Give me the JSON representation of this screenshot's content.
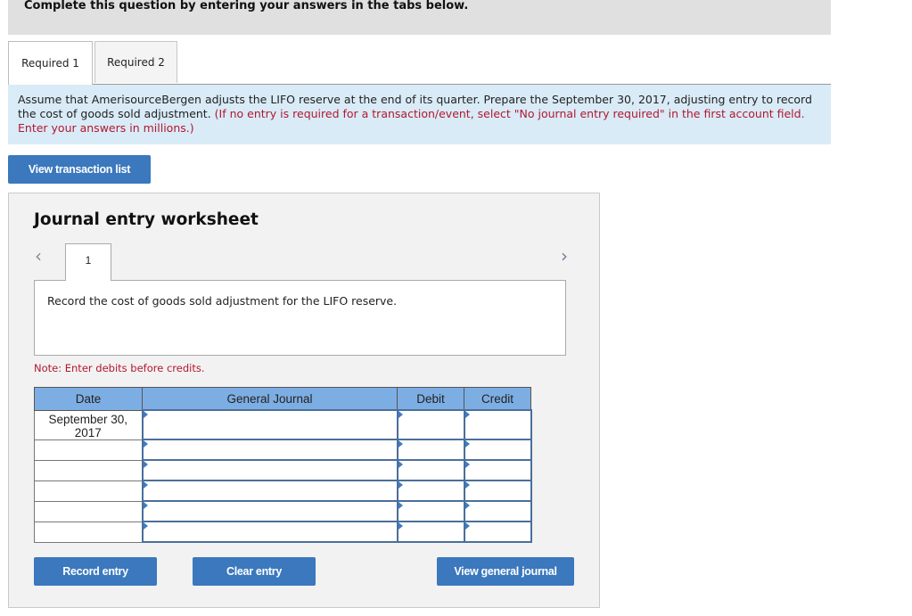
{
  "banner": {
    "text": "Complete this question by entering your answers in the tabs below."
  },
  "tabs": [
    {
      "label": "Required 1",
      "active": true
    },
    {
      "label": "Required 2",
      "active": false
    }
  ],
  "instructions": {
    "text": "Assume that AmerisourceBergen adjusts the LIFO reserve at the end of its quarter. Prepare the September 30, 2017, adjusting entry to record the cost of goods sold adjustment.",
    "note": "(If no entry is required for a transaction/event, select \"No journal entry required\" in the first account field. Enter your answers in millions.)"
  },
  "view_transaction_list": "View transaction list",
  "worksheet": {
    "title": "Journal entry worksheet",
    "prev_icon": "chevron-left-icon",
    "next_icon": "chevron-right-icon",
    "step": "1",
    "description": "Record the cost of goods sold adjustment for the LIFO reserve.",
    "note": "Note: Enter debits before credits.",
    "columns": [
      "Date",
      "General Journal",
      "Debit",
      "Credit"
    ],
    "rows": [
      {
        "date": "September 30, 2017",
        "account": "",
        "debit": "",
        "credit": ""
      },
      {
        "date": "",
        "account": "",
        "debit": "",
        "credit": ""
      },
      {
        "date": "",
        "account": "",
        "debit": "",
        "credit": ""
      },
      {
        "date": "",
        "account": "",
        "debit": "",
        "credit": ""
      },
      {
        "date": "",
        "account": "",
        "debit": "",
        "credit": ""
      },
      {
        "date": "",
        "account": "",
        "debit": "",
        "credit": ""
      }
    ],
    "buttons": {
      "record": "Record entry",
      "clear": "Clear entry",
      "view_journal": "View general journal"
    }
  },
  "colors": {
    "button": "#3b78bd",
    "header": "#7daee3",
    "instructions_bg": "#d9ebf7",
    "note_red": "#b3172e"
  }
}
